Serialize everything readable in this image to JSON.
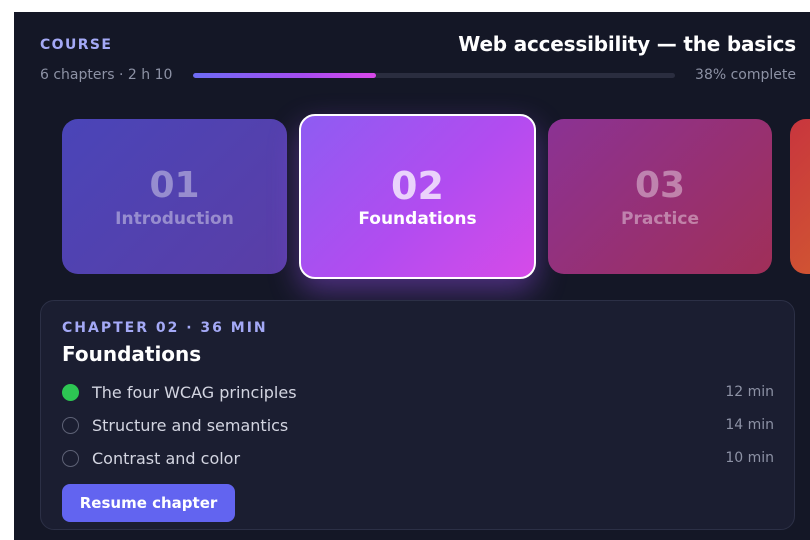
{
  "header": {
    "eyebrow": "COURSE",
    "title": "Web accessibility — the basics",
    "meta": "6 chapters · 2 h 10",
    "progress_percent": 38,
    "progress_label": "38% complete"
  },
  "chapters": [
    {
      "number": "01",
      "name": "Introduction",
      "state": "inactive"
    },
    {
      "number": "02",
      "name": "Foundations",
      "state": "selected"
    },
    {
      "number": "03",
      "name": "Practice",
      "state": "inactive"
    },
    {
      "number": "",
      "name": "",
      "state": "partially-visible"
    }
  ],
  "panel": {
    "meta": "CHAPTER 02 · 36 MIN",
    "title": "Foundations",
    "lessons": [
      {
        "title": "The four WCAG principles",
        "duration": "12 min",
        "done": true
      },
      {
        "title": "Structure and semantics",
        "duration": "14 min",
        "done": false
      },
      {
        "title": "Contrast and color",
        "duration": "10 min",
        "done": false
      }
    ],
    "resume_label": "Resume chapter"
  },
  "colors": {
    "background": "#141726",
    "accent": "#6264f0",
    "done": "#2dc653",
    "eyebrow": "#a4a9f6"
  },
  "icons": {
    "lesson_done": "check-circle-icon",
    "lesson_pending": "empty-circle-icon"
  }
}
